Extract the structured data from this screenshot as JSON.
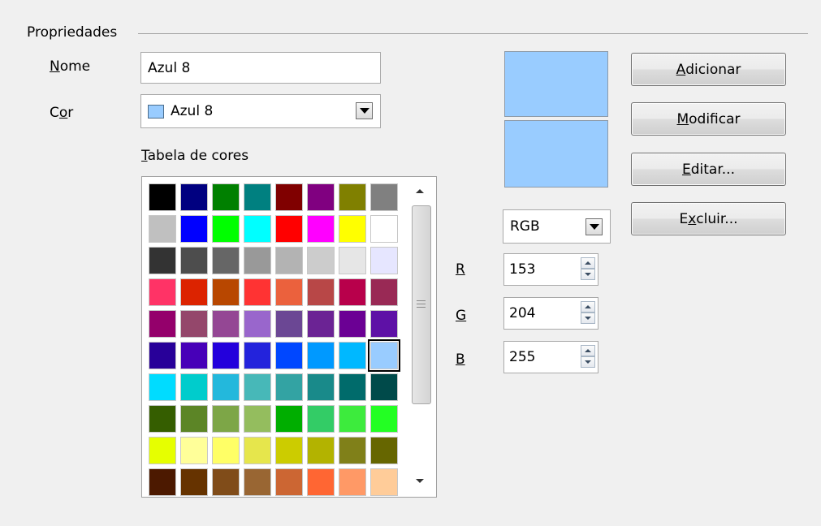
{
  "group": {
    "title": "Propriedades"
  },
  "name": {
    "label_first": "N",
    "label_rest": "ome",
    "value": "Azul 8"
  },
  "color": {
    "label_first": "C",
    "label_u": "o",
    "label_rest": "r",
    "selected": "Azul 8",
    "swatch": "#99ccff"
  },
  "table": {
    "label_first": "T",
    "label_rest": "abela de cores"
  },
  "palette": [
    [
      "#000000",
      "#000080",
      "#008000",
      "#008080",
      "#800000",
      "#800080",
      "#808000",
      "#808080"
    ],
    [
      "#c0c0c0",
      "#0000ff",
      "#00ff00",
      "#00ffff",
      "#ff0000",
      "#ff00ff",
      "#ffff00",
      "#ffffff"
    ],
    [
      "#333333",
      "#4d4d4d",
      "#666666",
      "#999999",
      "#b3b3b3",
      "#cccccc",
      "#e6e6e6",
      "#e6e6ff"
    ],
    [
      "#ff3366",
      "#dc2300",
      "#b84700",
      "#ff3333",
      "#eb613d",
      "#b84747",
      "#b8004b",
      "#992955"
    ],
    [
      "#94006b",
      "#94476b",
      "#944794",
      "#9966cc",
      "#6b4794",
      "#6b2394",
      "#6b0094",
      "#5e11a6"
    ],
    [
      "#280099",
      "#4700b8",
      "#2300dc",
      "#2323dc",
      "#0047ff",
      "#0099ff",
      "#00b8ff",
      "#99ccff"
    ],
    [
      "#00dcff",
      "#00cccc",
      "#23b8dc",
      "#47b8b8",
      "#33a3a3",
      "#198a8a",
      "#006b6b",
      "#004a4a"
    ],
    [
      "#355e00",
      "#5c8526",
      "#7da647",
      "#94bd5e",
      "#00ae00",
      "#33cc66",
      "#3deb3d",
      "#23ff23"
    ],
    [
      "#e6ff00",
      "#ffff99",
      "#ffff66",
      "#e6e64c",
      "#cccc00",
      "#b3b300",
      "#808019",
      "#666600"
    ],
    [
      "#4c1900",
      "#663300",
      "#804c19",
      "#996633",
      "#cc6633",
      "#ff6633",
      "#ff9966",
      "#ffcc99"
    ]
  ],
  "selected_cell": "#99ccff",
  "preview": {
    "top": "#99ccff",
    "bottom": "#99ccff"
  },
  "model": {
    "value": "RGB"
  },
  "rgb": {
    "r_label": "R",
    "r_value": "153",
    "g_label": "G",
    "g_value": "204",
    "b_label": "B",
    "b_value": "255"
  },
  "buttons": {
    "add_first": "A",
    "add_rest": "dicionar",
    "modify_first": "M",
    "modify_rest": "odificar",
    "edit_first": "E",
    "edit_rest": "ditar...",
    "delete_first": "E",
    "delete_u": "x",
    "delete_rest": "cluir..."
  }
}
